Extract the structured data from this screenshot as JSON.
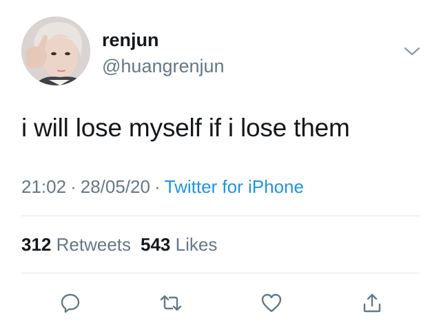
{
  "user": {
    "display_name": "renjun",
    "handle": "@huangrenjun"
  },
  "tweet": {
    "text": "i will lose myself if i lose them",
    "time": "21:02",
    "date": "28/05/20",
    "separator": "·",
    "source": "Twitter for iPhone"
  },
  "stats": {
    "retweets_count": "312",
    "retweets_label": "Retweets",
    "likes_count": "543",
    "likes_label": "Likes"
  },
  "icons": {
    "menu": "chevron-down-icon",
    "reply": "reply-icon",
    "retweet": "retweet-icon",
    "like": "heart-icon",
    "share": "share-icon"
  },
  "colors": {
    "text": "#14171a",
    "secondary": "#657786",
    "link": "#1b95e0",
    "divider": "#e1e8ed"
  }
}
